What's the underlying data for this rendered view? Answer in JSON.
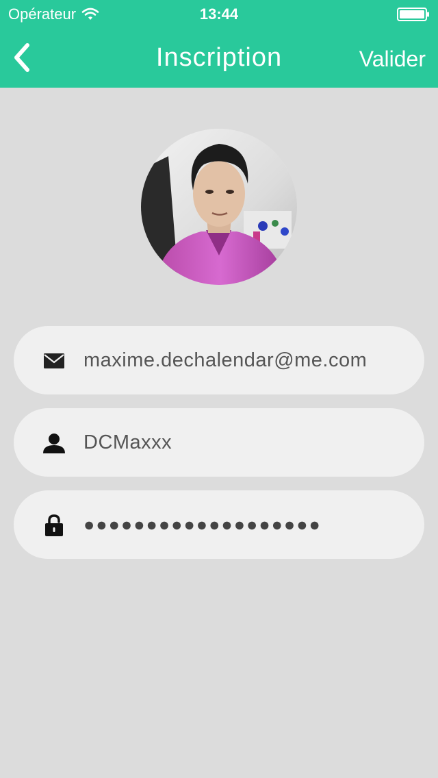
{
  "status_bar": {
    "carrier": "Opérateur",
    "time": "13:44",
    "wifi_icon": "wifi-icon",
    "battery_icon": "battery-icon"
  },
  "nav": {
    "back_icon": "chevron-left-icon",
    "title": "Inscription",
    "validate_label": "Valider"
  },
  "profile": {
    "avatar": "profile-photo"
  },
  "form": {
    "email": {
      "icon": "envelope-icon",
      "value": "maxime.dechalendar@me.com"
    },
    "username": {
      "icon": "user-icon",
      "value": "DCMaxxx"
    },
    "password": {
      "icon": "lock-icon",
      "value": "●●●●●●●●●●●●●●●●●●●"
    }
  },
  "colors": {
    "accent": "#29c99b",
    "background": "#dcdcdc",
    "field_background": "#f0f0f0",
    "text_field": "#555555"
  }
}
